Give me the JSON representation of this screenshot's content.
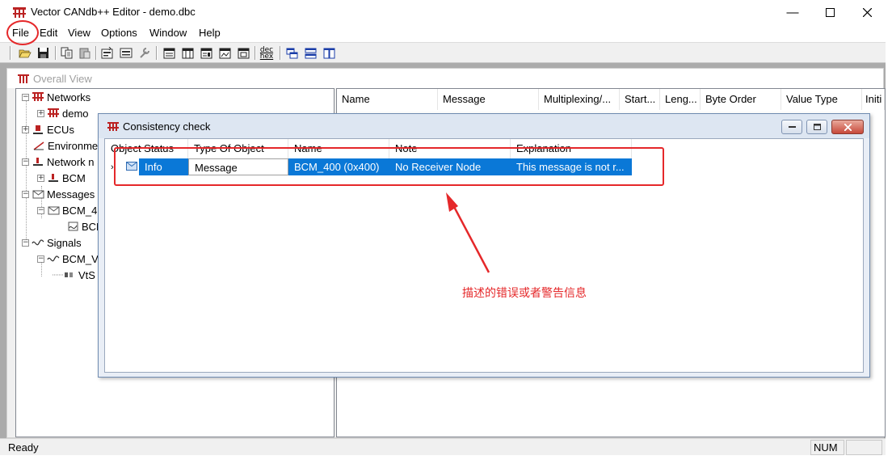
{
  "window": {
    "title": "Vector CANdb++ Editor - demo.dbc"
  },
  "menu": [
    "File",
    "Edit",
    "View",
    "Options",
    "Window",
    "Help"
  ],
  "toolbar": {
    "dec_hex_top": "dec",
    "dec_hex_bottom": "hex"
  },
  "overall_view": {
    "title": "Overall View"
  },
  "tree": {
    "networks": "Networks",
    "demo": "demo",
    "ecus": "ECUs",
    "environment": "Environme",
    "network_nodes": "Network n",
    "bcm": "BCM",
    "messages": "Messages",
    "bcm_msg": "BCM_4",
    "bcm_sig_short": "BCN",
    "signals": "Signals",
    "bcm_signal": "BCM_V",
    "vts": "VtS"
  },
  "list_columns": [
    "Name",
    "Message",
    "Multiplexing/...",
    "Start...",
    "Leng...",
    "Byte Order",
    "Value Type",
    "Initi"
  ],
  "consistency": {
    "title": "Consistency check",
    "columns": [
      "Object Status",
      "Type Of Object",
      "Name",
      "Note",
      "Explanation"
    ],
    "row": {
      "status": "Info",
      "type": "Message",
      "name": "BCM_400 (0x400)",
      "note": "No Receiver Node",
      "explanation": "This message is not r..."
    }
  },
  "status": {
    "ready": "Ready",
    "num": "NUM"
  },
  "annotation": {
    "text": "描述的错误或者警告信息",
    "color": "#e5282a"
  }
}
